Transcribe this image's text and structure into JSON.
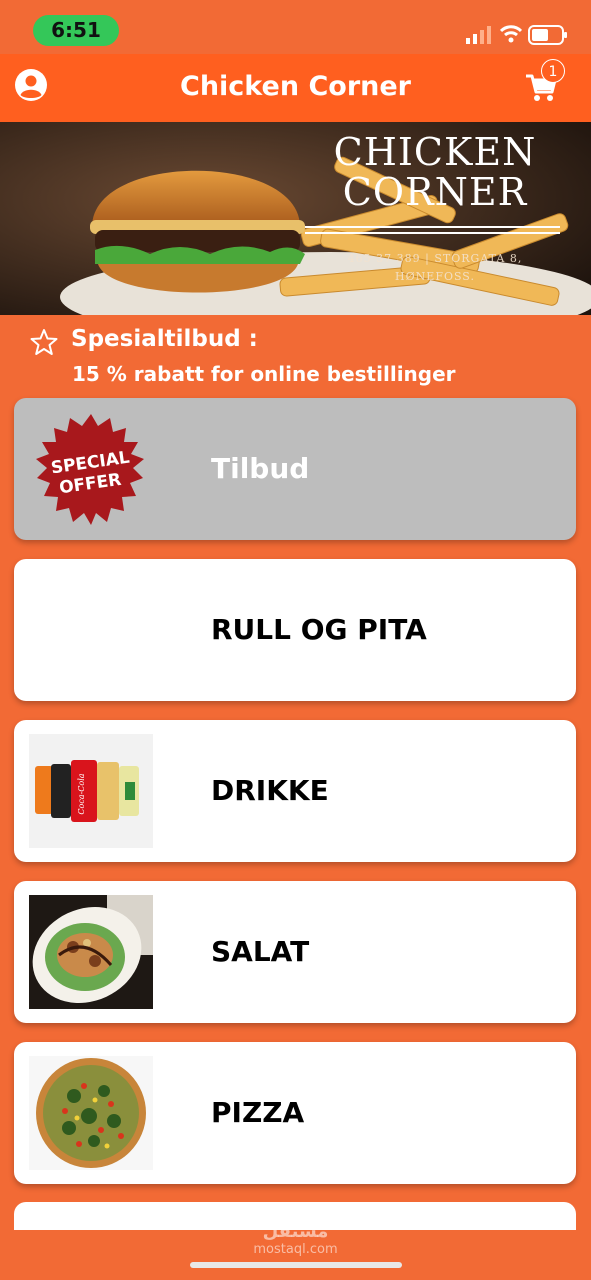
{
  "status_bar": {
    "time": "6:51"
  },
  "header": {
    "title": "Chicken Corner",
    "cart_count": "1"
  },
  "banner": {
    "brand_line1": "CHICKEN",
    "brand_line2": "CORNER",
    "address_line1": "465 37 389 | STORGATA 8,",
    "address_line2": "HØNEFOSS."
  },
  "promo": {
    "title": "Spesialtilbud :",
    "text": "15 % rabatt for online bestillinger"
  },
  "categories": [
    {
      "label": "Tilbud",
      "badge_line1": "SPECIAL",
      "badge_line2": "OFFER"
    },
    {
      "label": "RULL OG PITA"
    },
    {
      "label": "DRIKKE",
      "can_text": "Coca-Cola"
    },
    {
      "label": "SALAT"
    },
    {
      "label": "PIZZA"
    }
  ],
  "watermark": {
    "arabic": "مستقل",
    "latin": "mostaql.com"
  },
  "colors": {
    "background": "#f26a35",
    "header": "#ff5f1f",
    "offer_card": "#bdbdbd",
    "status_pill": "#34c759"
  }
}
